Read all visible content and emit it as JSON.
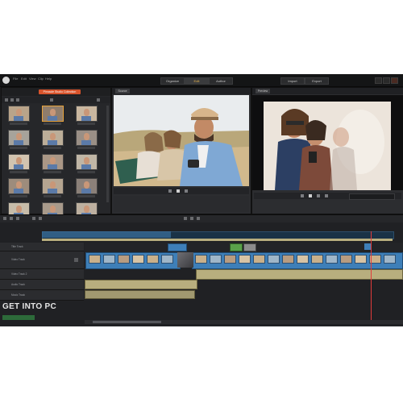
{
  "app": {
    "menu": [
      "File",
      "Edit",
      "View",
      "Clip",
      "Help"
    ],
    "modes": [
      "Organize",
      "Edit",
      "Author"
    ],
    "active_mode_index": 1,
    "right_buttons": [
      "Import",
      "Export"
    ],
    "accent_color": "#d7532b"
  },
  "library": {
    "tab_label": "Pinnacle Studio Collection",
    "thumb_count": 15,
    "selected_index": 1
  },
  "source_viewer": {
    "tab_label": "Source"
  },
  "preview_viewer": {
    "tab_label": "Preview"
  },
  "timeline": {
    "tracks": [
      "Title Track",
      "Video Track",
      "Video Track 2",
      "Audio Track",
      "Music Track"
    ]
  },
  "watermark": {
    "text": "GET INTO PC"
  }
}
